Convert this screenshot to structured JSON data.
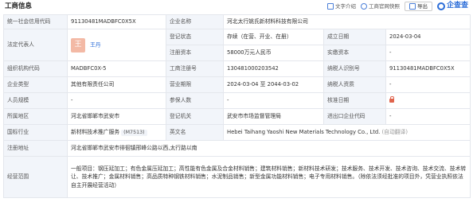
{
  "header": {
    "title": "工商信息",
    "copy_label": "文字介绍",
    "site_label": "工商官网快照",
    "export_label": "导出",
    "logo_text": "企查查"
  },
  "rows": {
    "credit_code_label": "统一社会信用代码",
    "credit_code": "91130481MADBFC0X5X",
    "company_name_label": "企业名称",
    "company_name": "河北太行姚氏新材料科技有限公司",
    "legal_rep_label": "法定代表人",
    "legal_rep_avatar": "王",
    "legal_rep_name": "王丹",
    "reg_status_label": "登记状态",
    "reg_status": "存续（在营、开业、在册）",
    "found_date_label": "成立日期",
    "found_date": "2024-03-04",
    "reg_capital_label": "注册资本",
    "reg_capital": "58000万元人民币",
    "paid_capital_label": "实缴资本",
    "paid_capital": "-",
    "org_code_label": "组织机构代码",
    "org_code": "MADBFC0X-5",
    "biz_reg_no_label": "工商注册号",
    "biz_reg_no": "130481000203542",
    "taxpayer_id_label": "纳税人识别号",
    "taxpayer_id": "91130481MADBFC0X5X",
    "company_type_label": "企业类型",
    "company_type": "其他有限责任公司",
    "biz_term_label": "营业期限",
    "biz_term": "2024-03-04 至 2044-03-02",
    "taxpayer_qual_label": "纳税人资质",
    "taxpayer_qual": "-",
    "staff_size_label": "人员规模",
    "staff_size": "-",
    "insured_label": "参保人数",
    "insured": "-",
    "approval_date_label": "核准日期",
    "region_label": "所属地区",
    "region": "河北省邯郸市武安市",
    "reg_authority_label": "登记机关",
    "reg_authority": "武安市市场监督管理局",
    "ie_code_label": "进出口企业代码",
    "ie_code": "-",
    "industry_label": "国标行业",
    "industry": "新材料技术推广服务",
    "industry_code": "(M7513)",
    "english_name_label": "英文名",
    "english_name": "Hebei Taihang Yaoshi New Materials Technology Co., Ltd.",
    "english_name_tag": "(自动翻译)",
    "reg_address_label": "注册地址",
    "reg_address": "河北省邯郸市武安市徘徊镇邢峰公路以西,太行路以南",
    "biz_scope_label": "经营范围",
    "biz_scope": "一般项目：钢压延加工；有色金属压延加工；高性能有色金属及合金材料销售；建筑材料销售；新材料技术研发；技术服务、技术开发、技术咨询、技术交流、技术转让、技术推广；金属材料销售；高品质特种钢铁材料销售；水泥制品销售；新型金属功能材料销售；电子专用材料销售。（除依法须经批准的项目外，凭营业执照依法自主开展经营活动）"
  }
}
